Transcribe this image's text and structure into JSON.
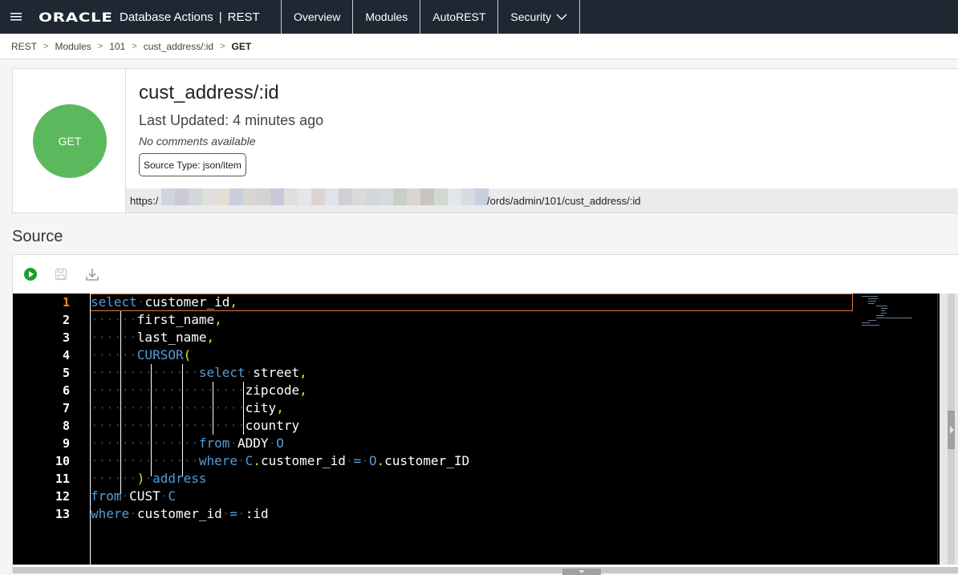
{
  "header": {
    "menu_icon": "hamburger-icon",
    "brand": "ORACLE",
    "app_name": "Database Actions",
    "separator": "|",
    "section": "REST",
    "nav": [
      {
        "label": "Overview"
      },
      {
        "label": "Modules"
      },
      {
        "label": "AutoREST"
      },
      {
        "label": "Security",
        "has_dropdown": true
      }
    ]
  },
  "breadcrumb": {
    "items": [
      "REST",
      "Modules",
      "101",
      "cust_address/:id"
    ],
    "current": "GET",
    "separator": ">"
  },
  "endpoint": {
    "method": "GET",
    "method_color": "#5cb85c",
    "title": "cust_address/:id",
    "last_updated": "Last Updated: 4 minutes ago",
    "comments": "No comments available",
    "source_type": "Source Type: json/item",
    "url_prefix": "https:/",
    "url_suffix": "/ords/admin/101/cust_address/:id"
  },
  "source": {
    "title": "Source",
    "toolbar": {
      "run_icon": "run-icon",
      "save_icon": "save-icon",
      "download_icon": "download-icon"
    },
    "active_line": 1,
    "line_numbers": [
      "1",
      "2",
      "3",
      "4",
      "5",
      "6",
      "7",
      "8",
      "9",
      "10",
      "11",
      "12",
      "13"
    ],
    "lines": [
      [
        {
          "t": "select",
          "c": "kw"
        },
        {
          "t": "·",
          "c": "ws"
        },
        {
          "t": "customer_id"
        },
        {
          "t": ",",
          "c": "pn"
        }
      ],
      [
        {
          "t": "······",
          "c": "ws"
        },
        {
          "t": "first_name"
        },
        {
          "t": ",",
          "c": "pn"
        }
      ],
      [
        {
          "t": "······",
          "c": "ws"
        },
        {
          "t": "last_name"
        },
        {
          "t": ",",
          "c": "pn"
        }
      ],
      [
        {
          "t": "······",
          "c": "ws"
        },
        {
          "t": "CURSOR",
          "c": "kw"
        },
        {
          "t": "(",
          "c": "pn"
        }
      ],
      [
        {
          "t": "··············",
          "c": "ws"
        },
        {
          "t": "select",
          "c": "kw"
        },
        {
          "t": "·",
          "c": "ws"
        },
        {
          "t": "street"
        },
        {
          "t": ",",
          "c": "pn"
        }
      ],
      [
        {
          "t": "····················",
          "c": "ws"
        },
        {
          "t": "zipcode"
        },
        {
          "t": ",",
          "c": "pn"
        }
      ],
      [
        {
          "t": "····················",
          "c": "ws"
        },
        {
          "t": "city"
        },
        {
          "t": ",",
          "c": "pn"
        }
      ],
      [
        {
          "t": "····················",
          "c": "ws"
        },
        {
          "t": "country"
        }
      ],
      [
        {
          "t": "··············",
          "c": "ws"
        },
        {
          "t": "from",
          "c": "kw"
        },
        {
          "t": "·",
          "c": "ws"
        },
        {
          "t": "ADDY"
        },
        {
          "t": "·",
          "c": "ws"
        },
        {
          "t": "O",
          "c": "kw"
        }
      ],
      [
        {
          "t": "··············",
          "c": "ws"
        },
        {
          "t": "where",
          "c": "kw"
        },
        {
          "t": "·",
          "c": "ws"
        },
        {
          "t": "C",
          "c": "kw"
        },
        {
          "t": ".",
          "c": "pn"
        },
        {
          "t": "customer_id"
        },
        {
          "t": "·",
          "c": "ws"
        },
        {
          "t": "=",
          "c": "op"
        },
        {
          "t": "·",
          "c": "ws"
        },
        {
          "t": "O",
          "c": "kw"
        },
        {
          "t": ".",
          "c": "pn"
        },
        {
          "t": "customer_ID"
        }
      ],
      [
        {
          "t": "······",
          "c": "ws"
        },
        {
          "t": ")",
          "c": "pn"
        },
        {
          "t": "·",
          "c": "ws"
        },
        {
          "t": "address",
          "c": "kw"
        }
      ],
      [
        {
          "t": "from",
          "c": "kw"
        },
        {
          "t": "·",
          "c": "ws"
        },
        {
          "t": "CUST"
        },
        {
          "t": "·",
          "c": "ws"
        },
        {
          "t": "C",
          "c": "kw"
        }
      ],
      [
        {
          "t": "where",
          "c": "kw"
        },
        {
          "t": "·",
          "c": "ws"
        },
        {
          "t": "customer_id"
        },
        {
          "t": "·",
          "c": "ws"
        },
        {
          "t": "=",
          "c": "op"
        },
        {
          "t": "·",
          "c": "ws"
        },
        {
          "t": ":id"
        }
      ]
    ]
  }
}
